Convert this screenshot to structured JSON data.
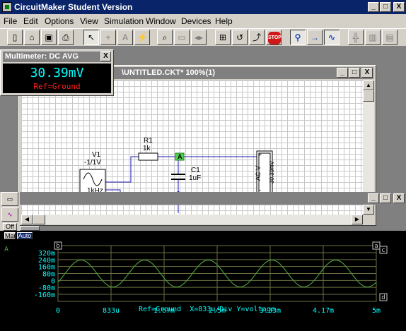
{
  "app": {
    "title": "CircuitMaker Student Version",
    "window_buttons": [
      "_",
      "□",
      "X"
    ]
  },
  "menu": [
    "File",
    "Edit",
    "Options",
    "View",
    "Simulation",
    "Window",
    "Devices",
    "Help"
  ],
  "toolbar": {
    "stop_label": "STOP",
    "text_tool": "A"
  },
  "multimeter": {
    "title": "Multimeter: DC AVG",
    "close": "X",
    "value": "30.39mV",
    "reference": "Ref=Ground"
  },
  "schematic": {
    "title": "\\UNTITLED.CKT* 100%(1)",
    "source": {
      "name": "V1",
      "value": "-1/1V",
      "freq": "1kHz"
    },
    "resistor": {
      "name": "R1",
      "value": "1k"
    },
    "capacitor": {
      "name": "C1",
      "value": "1uF"
    },
    "probe": "A",
    "meter_label": "AC V",
    "meter_value": "30.39mV",
    "meter_plus": "+",
    "meter_minus": "-"
  },
  "waveform": {
    "probe_label": "A",
    "side_labels": [
      "Off",
      "Man",
      "Auto"
    ],
    "markers": {
      "a": "a",
      "b": "b",
      "c": "c",
      "d": "d"
    },
    "footer": "Ref=Ground  X=833u/Div Y=voltage"
  },
  "chart_data": {
    "type": "line",
    "title": "",
    "xlabel": "",
    "ylabel": "voltage",
    "x_ticks": [
      "0",
      "833u",
      "1.67m",
      "2.5m",
      "3.33m",
      "4.17m",
      "5m"
    ],
    "y_ticks": [
      "320m",
      "240m",
      "160m",
      "80m",
      "0",
      "-80m",
      "-160m"
    ],
    "xlim": [
      0,
      0.005
    ],
    "ylim": [
      -0.16,
      0.32
    ],
    "series": [
      {
        "name": "A",
        "color": "#4a9a3a",
        "amplitude": 0.155,
        "offset": 0.08,
        "frequency": 1000,
        "phase_deg": -40
      }
    ],
    "grid": true,
    "colors": {
      "grid": "#6a7040",
      "axis_text": "#00ffff",
      "footer": "#00ffff"
    }
  }
}
